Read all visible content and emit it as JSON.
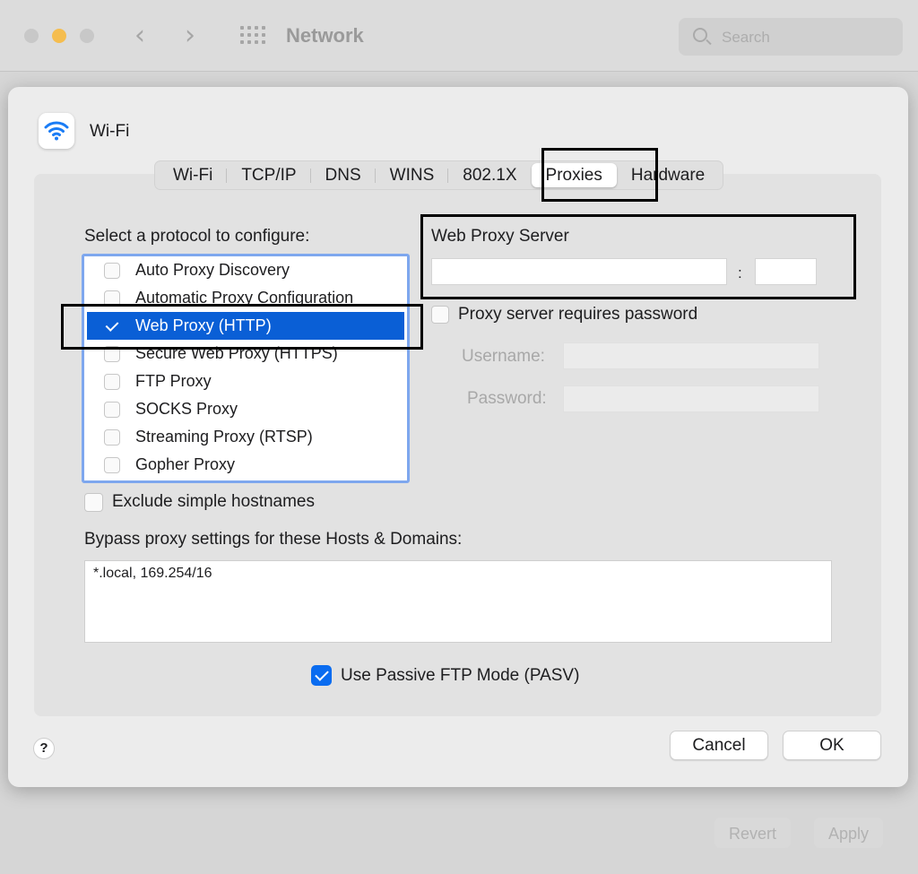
{
  "window": {
    "title": "Network",
    "search_placeholder": "Search",
    "revert_label": "Revert",
    "apply_label": "Apply"
  },
  "sheet": {
    "service_name": "Wi-Fi",
    "tabs": [
      {
        "label": "Wi-Fi",
        "active": false
      },
      {
        "label": "TCP/IP",
        "active": false
      },
      {
        "label": "DNS",
        "active": false
      },
      {
        "label": "WINS",
        "active": false
      },
      {
        "label": "802.1X",
        "active": false
      },
      {
        "label": "Proxies",
        "active": true
      },
      {
        "label": "Hardware",
        "active": false
      }
    ],
    "select_protocol_label": "Select a protocol to configure:",
    "protocols": [
      {
        "label": "Auto Proxy Discovery",
        "checked": false,
        "selected": false
      },
      {
        "label": "Automatic Proxy Configuration",
        "checked": false,
        "selected": false
      },
      {
        "label": "Web Proxy (HTTP)",
        "checked": true,
        "selected": true
      },
      {
        "label": "Secure Web Proxy (HTTPS)",
        "checked": false,
        "selected": false
      },
      {
        "label": "FTP Proxy",
        "checked": false,
        "selected": false
      },
      {
        "label": "SOCKS Proxy",
        "checked": false,
        "selected": false
      },
      {
        "label": "Streaming Proxy (RTSP)",
        "checked": false,
        "selected": false
      },
      {
        "label": "Gopher Proxy",
        "checked": false,
        "selected": false
      }
    ],
    "server_title": "Web Proxy Server",
    "server_value": "",
    "port_value": "",
    "colon": ":",
    "requires_password_label": "Proxy server requires password",
    "requires_password_checked": false,
    "username_label": "Username:",
    "password_label": "Password:",
    "exclude_label": "Exclude simple hostnames",
    "exclude_checked": false,
    "bypass_label": "Bypass proxy settings for these Hosts & Domains:",
    "bypass_value": "*.local, 169.254/16",
    "pasv_label": "Use Passive FTP Mode (PASV)",
    "pasv_checked": true,
    "help_label": "?",
    "cancel_label": "Cancel",
    "ok_label": "OK"
  },
  "colors": {
    "selection_blue": "#0a5fd6",
    "checkbox_blue": "#0a6cf0",
    "list_border": "#7ea7ee",
    "highlight_frame": "#000000"
  }
}
